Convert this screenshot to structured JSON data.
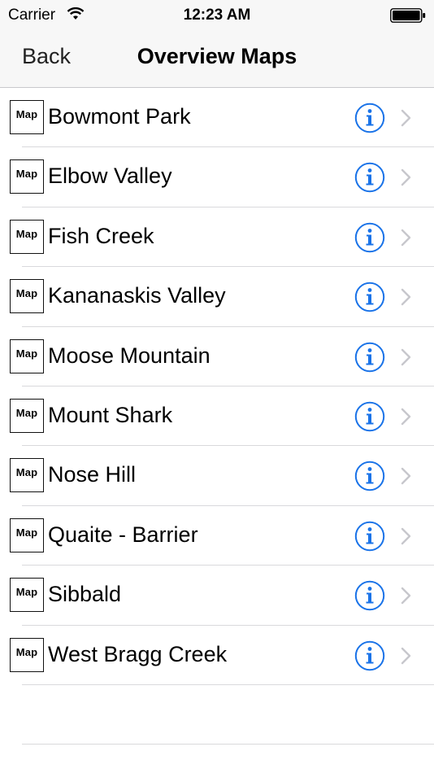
{
  "status_bar": {
    "carrier": "Carrier",
    "time": "12:23 AM"
  },
  "nav": {
    "back_label": "Back",
    "title": "Overview Maps"
  },
  "list": {
    "badge_label": "Map",
    "items": [
      {
        "name": "Bowmont Park"
      },
      {
        "name": "Elbow Valley"
      },
      {
        "name": "Fish Creek"
      },
      {
        "name": "Kananaskis Valley"
      },
      {
        "name": "Moose Mountain"
      },
      {
        "name": "Mount Shark"
      },
      {
        "name": "Nose Hill"
      },
      {
        "name": "Quaite - Barrier"
      },
      {
        "name": "Sibbald"
      },
      {
        "name": "West Bragg Creek"
      }
    ]
  },
  "colors": {
    "accent": "#1a73e8",
    "separator": "#d9d9dc",
    "chevron": "#c7c7cc"
  },
  "icons": {
    "info": "info-circle-icon",
    "chevron": "chevron-right-icon",
    "wifi": "wifi-icon",
    "battery": "battery-icon"
  }
}
